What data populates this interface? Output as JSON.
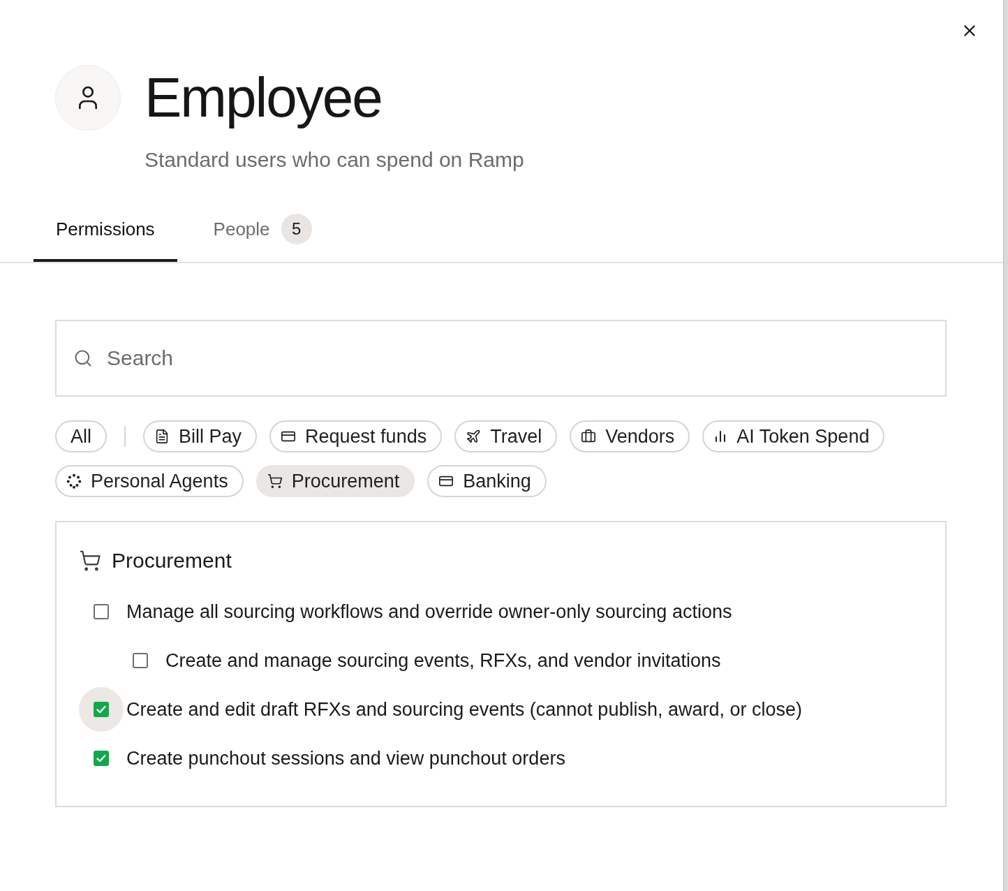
{
  "header": {
    "title": "Employee",
    "subtitle": "Standard users who can spend on Ramp"
  },
  "tabs": [
    {
      "label": "Permissions",
      "selected": true
    },
    {
      "label": "People",
      "count": "5",
      "selected": false
    }
  ],
  "search": {
    "placeholder": "Search"
  },
  "filters": [
    {
      "label": "All",
      "kind": "plain",
      "selected": false
    },
    {
      "label": "Bill Pay",
      "kind": "document",
      "selected": false
    },
    {
      "label": "Request funds",
      "kind": "card",
      "selected": false
    },
    {
      "label": "Travel",
      "kind": "plane",
      "selected": false
    },
    {
      "label": "Vendors",
      "kind": "briefcase",
      "selected": false
    },
    {
      "label": "AI Token Spend",
      "kind": "chart",
      "selected": false
    },
    {
      "label": "Personal Agents",
      "kind": "dots",
      "selected": false
    },
    {
      "label": "Procurement",
      "kind": "cart",
      "selected": true
    },
    {
      "label": "Banking",
      "kind": "card",
      "selected": false
    }
  ],
  "section": {
    "title": "Procurement",
    "permissions": [
      {
        "label": "Manage all sourcing workflows and override owner-only sourcing actions",
        "checked": false,
        "hovered": false,
        "children": [
          {
            "label": "Create and manage sourcing events, RFXs, and vendor invitations",
            "checked": false,
            "hovered": false
          }
        ]
      },
      {
        "label": "Create and edit draft RFXs and sourcing events (cannot publish, award, or close)",
        "checked": true,
        "hovered": true
      },
      {
        "label": "Create punchout sessions and view punchout orders",
        "checked": true,
        "hovered": false
      }
    ]
  }
}
